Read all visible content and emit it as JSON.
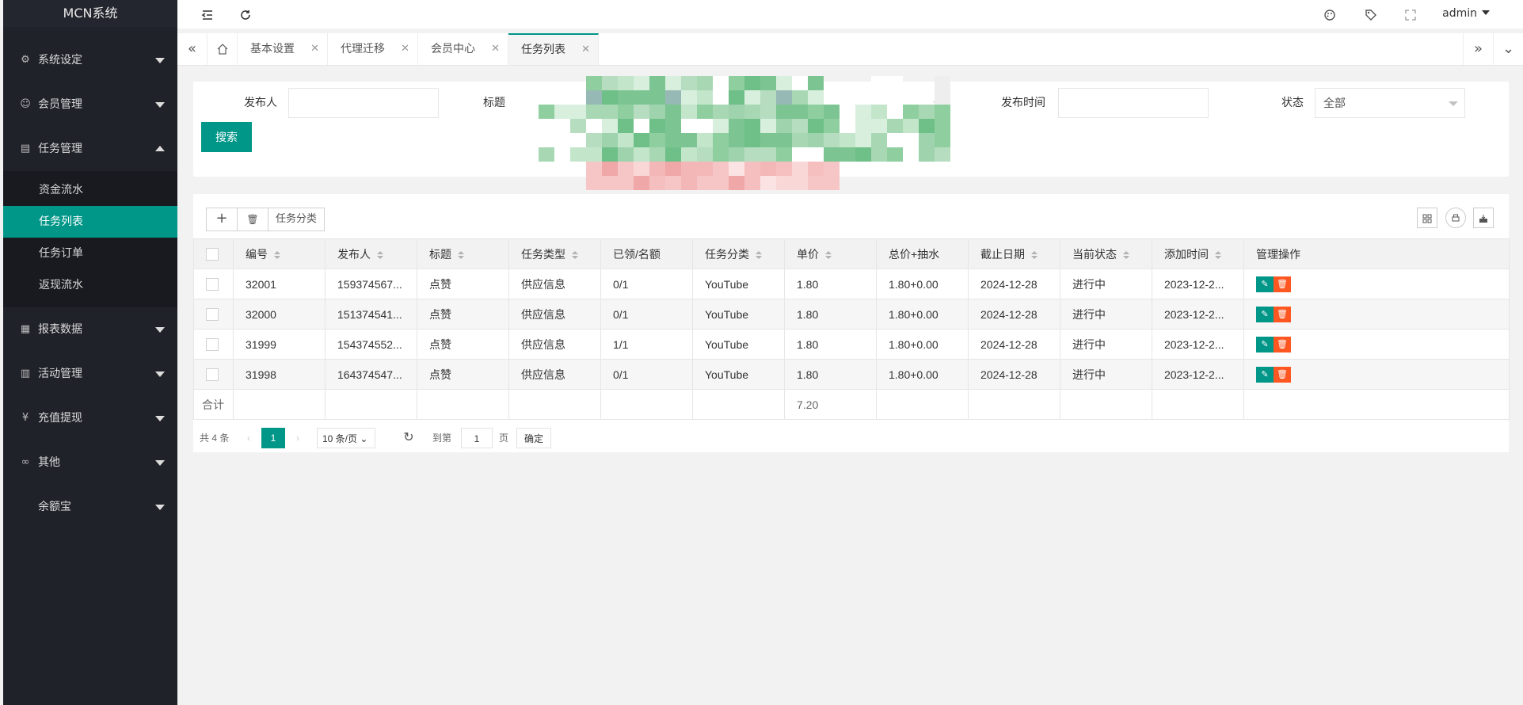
{
  "app": {
    "brand": "MCN系统"
  },
  "sidebar": {
    "items": [
      {
        "label": "系统设定",
        "icon": "gear-icon",
        "glyph": "⚙"
      },
      {
        "label": "会员管理",
        "icon": "user-icon",
        "glyph": "☺"
      },
      {
        "label": "任务管理",
        "icon": "document-icon",
        "glyph": "▤"
      },
      {
        "label": "报表数据",
        "icon": "report-icon",
        "glyph": "▦"
      },
      {
        "label": "活动管理",
        "icon": "book-icon",
        "glyph": "▥"
      },
      {
        "label": "充值提现",
        "icon": "yen-icon",
        "glyph": "¥"
      },
      {
        "label": "其他",
        "icon": "link-icon",
        "glyph": "∞"
      },
      {
        "label": "余额宝",
        "icon": "",
        "glyph": ""
      }
    ],
    "sub_items": [
      "资金流水",
      "任务列表",
      "任务订单",
      "返现流水"
    ]
  },
  "header": {
    "admin": "admin"
  },
  "tabs": [
    {
      "label": "基本设置"
    },
    {
      "label": "代理迁移"
    },
    {
      "label": "会员中心"
    },
    {
      "label": "任务列表"
    }
  ],
  "search": {
    "publisher_label": "发布人",
    "title_label": "标题",
    "time_label": "发布时间",
    "status_label": "状态",
    "status_value": "全部",
    "button": "搜索"
  },
  "toolbar": {
    "add": "+",
    "delete": "🗑",
    "category": "任务分类"
  },
  "table": {
    "columns": [
      "编号",
      "发布人",
      "标题",
      "任务类型",
      "已领/名额",
      "任务分类",
      "单价",
      "总价+抽水",
      "截止日期",
      "当前状态",
      "添加时间",
      "管理操作"
    ],
    "rows": [
      [
        "32001",
        "159374567...",
        "点赞",
        "供应信息",
        "0/1",
        "YouTube",
        "1.80",
        "1.80+0.00",
        "2024-12-28",
        "进行中",
        "2023-12-2..."
      ],
      [
        "32000",
        "151374541...",
        "点赞",
        "供应信息",
        "0/1",
        "YouTube",
        "1.80",
        "1.80+0.00",
        "2024-12-28",
        "进行中",
        "2023-12-2..."
      ],
      [
        "31999",
        "154374552...",
        "点赞",
        "供应信息",
        "1/1",
        "YouTube",
        "1.80",
        "1.80+0.00",
        "2024-12-28",
        "进行中",
        "2023-12-2..."
      ],
      [
        "31998",
        "164374547...",
        "点赞",
        "供应信息",
        "0/1",
        "YouTube",
        "1.80",
        "1.80+0.00",
        "2024-12-28",
        "进行中",
        "2023-12-2..."
      ]
    ],
    "total_label": "合计",
    "total_value": "7.20"
  },
  "pager": {
    "total": "共 4 条",
    "page": "1",
    "page_size": "10 条/页",
    "goto": "到第",
    "goto_value": "1",
    "unit": "页",
    "confirm": "确定"
  },
  "colors": {
    "accent": "#009688",
    "danger": "#ff5722",
    "sidebar": "#20222a"
  }
}
